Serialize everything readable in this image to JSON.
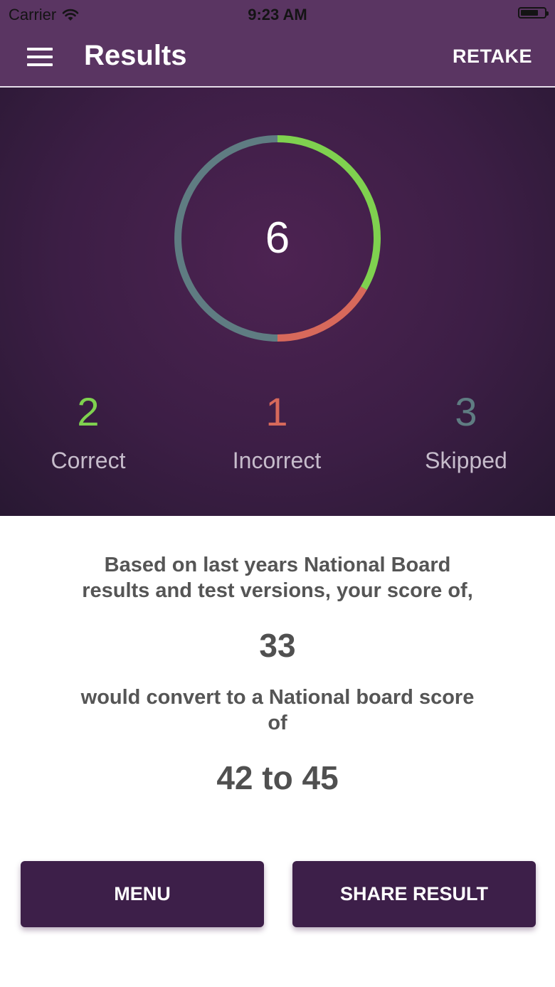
{
  "status_bar": {
    "carrier": "Carrier",
    "time": "9:23 AM",
    "wifi_icon": "wifi-icon",
    "battery_icon": "battery-icon"
  },
  "navbar": {
    "title": "Results",
    "retake_label": "RETAKE",
    "menu_icon": "hamburger-menu-icon"
  },
  "summary": {
    "total": "6",
    "correct": {
      "value": "2",
      "label": "Correct"
    },
    "incorrect": {
      "value": "1",
      "label": "Incorrect"
    },
    "skipped": {
      "value": "3",
      "label": "Skipped"
    }
  },
  "chart_data": {
    "type": "pie",
    "labels": [
      "Correct",
      "Incorrect",
      "Skipped"
    ],
    "values": [
      2,
      1,
      3
    ],
    "colors": [
      "#7fd14f",
      "#d7695b",
      "#5f7c82"
    ]
  },
  "conversion": {
    "line1": "Based on last years National Board",
    "line2": "results and test versions, your score of,",
    "score": "33",
    "line3": "would convert to a National board score",
    "line4": "of",
    "range": "42 to 45"
  },
  "buttons": {
    "menu": "MENU",
    "share": "SHARE RESULT"
  },
  "colors": {
    "header": "#5a3562",
    "button": "#3d1f49",
    "correct": "#7fd14f",
    "incorrect": "#d7695b",
    "skipped": "#5f7c82"
  }
}
